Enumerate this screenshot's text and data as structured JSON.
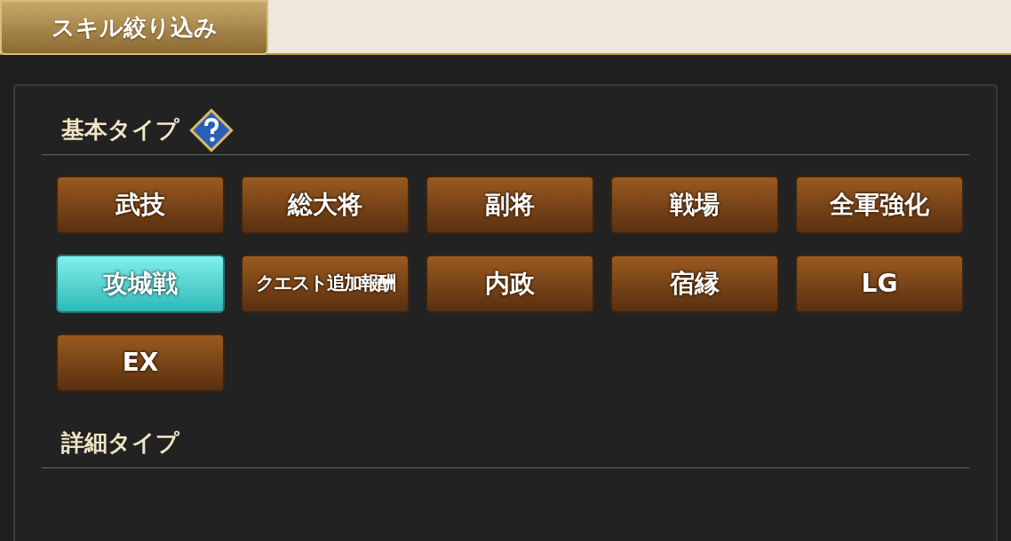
{
  "tab": {
    "title": "スキル絞り込み"
  },
  "sections": [
    {
      "title": "基本タイプ",
      "help": true,
      "buttons": [
        {
          "label": "武技",
          "selected": false
        },
        {
          "label": "総大将",
          "selected": false
        },
        {
          "label": "副将",
          "selected": false
        },
        {
          "label": "戦場",
          "selected": false
        },
        {
          "label": "全軍強化",
          "selected": false
        },
        {
          "label": "攻城戦",
          "selected": true
        },
        {
          "label": "クエスト追加報酬",
          "selected": false
        },
        {
          "label": "内政",
          "selected": false
        },
        {
          "label": "宿縁",
          "selected": false
        },
        {
          "label": "LG",
          "selected": false
        },
        {
          "label": "EX",
          "selected": false
        }
      ]
    },
    {
      "title": "詳細タイプ",
      "help": false
    }
  ]
}
